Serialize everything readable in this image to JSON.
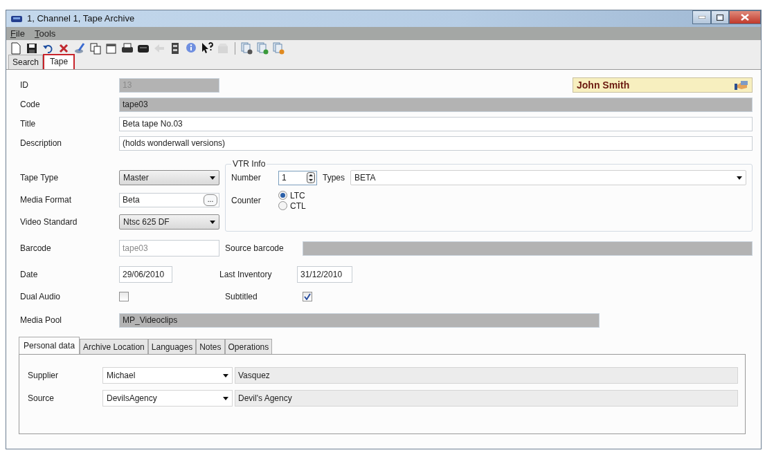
{
  "window": {
    "title": "1, Channel 1, Tape Archive"
  },
  "menu": [
    {
      "label": "File"
    },
    {
      "label": "Tools"
    }
  ],
  "toolbar": [
    {
      "kind": "new",
      "disabled": false
    },
    {
      "kind": "save",
      "disabled": false
    },
    {
      "kind": "undo",
      "disabled": false
    },
    {
      "kind": "delete",
      "disabled": false
    },
    {
      "kind": "broom",
      "disabled": false
    },
    {
      "kind": "copy",
      "disabled": false
    },
    {
      "kind": "window",
      "disabled": false
    },
    {
      "kind": "print",
      "disabled": false
    },
    {
      "kind": "tape",
      "disabled": false
    },
    {
      "kind": "arrow",
      "disabled": true
    },
    {
      "kind": "cabinet",
      "disabled": false
    },
    {
      "kind": "info",
      "disabled": false
    },
    {
      "kind": "help",
      "disabled": false
    },
    {
      "kind": "box",
      "disabled": true
    },
    {
      "kind": "separator"
    },
    {
      "kind": "docs",
      "disabled": false,
      "color": "#555555"
    },
    {
      "kind": "docs",
      "disabled": false,
      "color": "#3a9a3a"
    },
    {
      "kind": "docs",
      "disabled": false,
      "color": "#e08a20"
    }
  ],
  "tabs": [
    {
      "label": "Search",
      "selected": false
    },
    {
      "label": "Tape",
      "selected": true
    }
  ],
  "user": "John Smith",
  "fields": {
    "id": {
      "label": "ID",
      "value": "13",
      "disabled": true,
      "dimmed": true
    },
    "code": {
      "label": "Code",
      "value": "tape03",
      "disabled": true,
      "dimmed": false
    },
    "title": {
      "label": "Title",
      "value": "Beta tape No.03",
      "disabled": false,
      "dimmed": false
    },
    "description": {
      "label": "Description",
      "value": "(holds wonderwall versions)",
      "disabled": false,
      "dimmed": false
    }
  },
  "tape_type": {
    "label": "Tape Type",
    "value": "Master"
  },
  "media_format": {
    "label": "Media Format",
    "value": "Beta",
    "button": "..."
  },
  "video_standard": {
    "label": "Video Standard",
    "value": "Ntsc 625 DF"
  },
  "vtr_info": {
    "title": "VTR Info",
    "number": {
      "label": "Number",
      "value": "1"
    },
    "types": {
      "label": "Types",
      "value": "BETA"
    },
    "counter": {
      "label": "Counter",
      "options": [
        {
          "label": "LTC",
          "selected": true
        },
        {
          "label": "CTL",
          "selected": false
        }
      ]
    }
  },
  "barcode": {
    "label": "Barcode",
    "value": "tape03",
    "dimmed": true
  },
  "source_barcode": {
    "label": "Source barcode"
  },
  "date": {
    "label": "Date",
    "value": "29/06/2010"
  },
  "last_inventory": {
    "label": "Last Inventory",
    "value": "31/12/2010"
  },
  "dual_audio": {
    "label": "Dual Audio",
    "checked": false
  },
  "subtitled": {
    "label": "Subtitled",
    "checked": true
  },
  "media_pool": {
    "label": "Media Pool",
    "value": "MP_Videoclips"
  },
  "subtabs": [
    {
      "label": "Personal data",
      "selected": true
    },
    {
      "label": "Archive Location",
      "selected": false
    },
    {
      "label": "Languages",
      "selected": false
    },
    {
      "label": "Notes",
      "selected": false
    },
    {
      "label": "Operations",
      "selected": false
    }
  ],
  "personal": [
    {
      "label": "Supplier",
      "value": "Michael",
      "name": "Vasquez"
    },
    {
      "label": "Source",
      "value": "DevilsAgency",
      "name": "Devil's Agency"
    }
  ]
}
